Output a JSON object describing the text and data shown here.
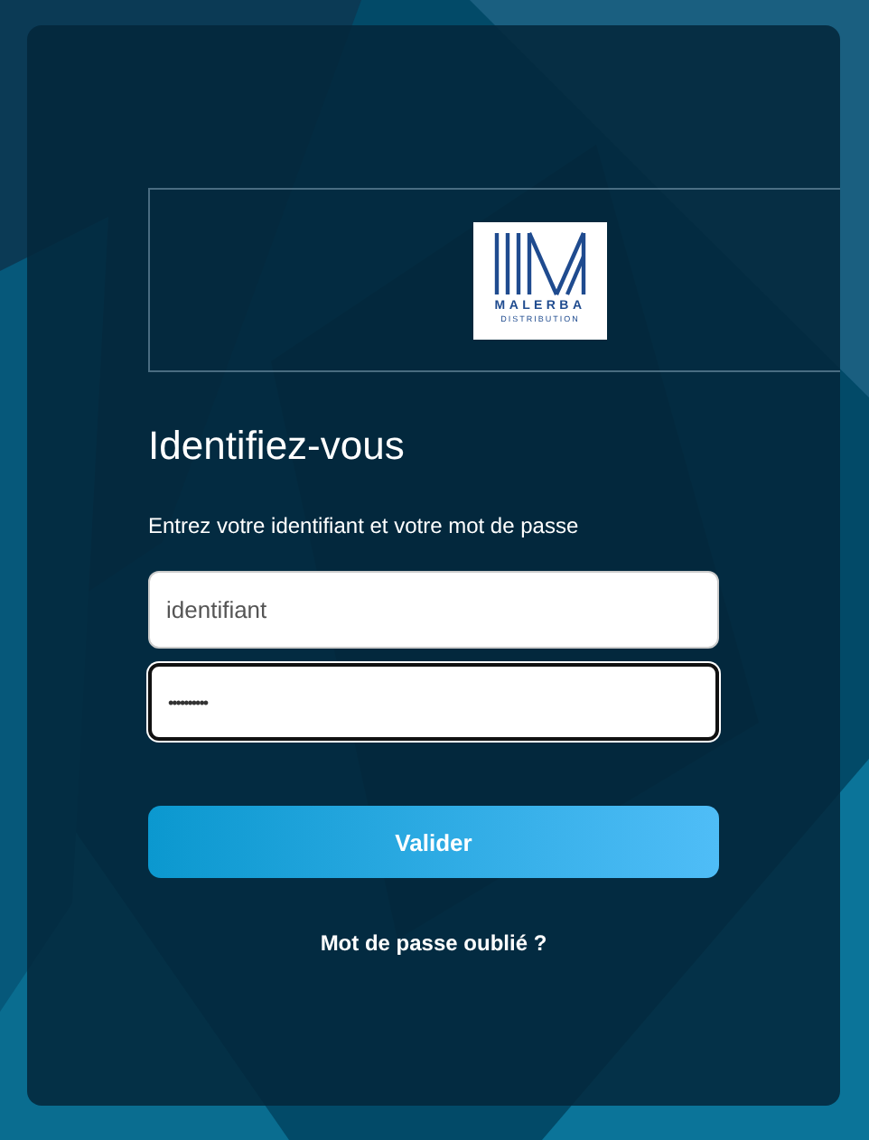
{
  "logo": {
    "brand": "MALERBA",
    "subtitle": "DISTRIBUTION"
  },
  "title": "Identifiez-vous",
  "instructions": "Entrez votre identifiant et votre mot de passe",
  "fields": [
    {
      "kind": "text",
      "placeholder": "identifiant",
      "focused": false
    },
    {
      "kind": "password",
      "value": "••••••••••",
      "focused": true
    }
  ],
  "submit": "Valider",
  "forgot_link": "Mot de passe oublié ?"
}
